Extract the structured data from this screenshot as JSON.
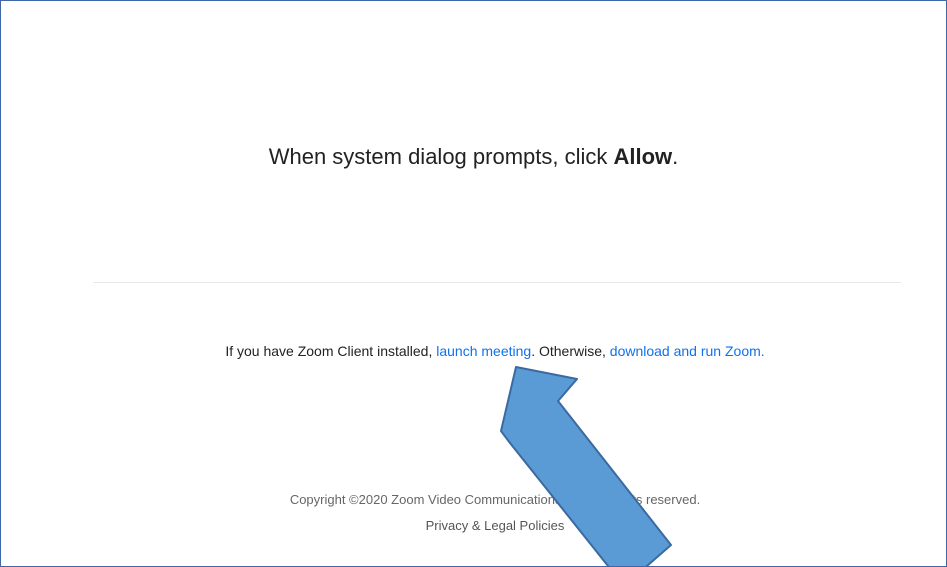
{
  "prompt": {
    "text_before": "When system dialog prompts, click ",
    "bold_word": "Allow",
    "text_after": "."
  },
  "launch": {
    "text_before": "If you have Zoom Client installed, ",
    "launch_link": "launch meeting",
    "text_middle": ". Otherwise, ",
    "download_link": "download and run Zoom."
  },
  "footer": {
    "copyright": "Copyright ©2020 Zoom Video Communications, Inc. All rights reserved.",
    "policies_link": "Privacy & Legal Policies"
  },
  "annotation": {
    "arrow_color": "#5b9bd5",
    "arrow_outline": "#3a6aa0",
    "icon": "arrow-up-left-icon"
  },
  "colors": {
    "link": "#0e72ed",
    "border": "#3f67a8"
  }
}
